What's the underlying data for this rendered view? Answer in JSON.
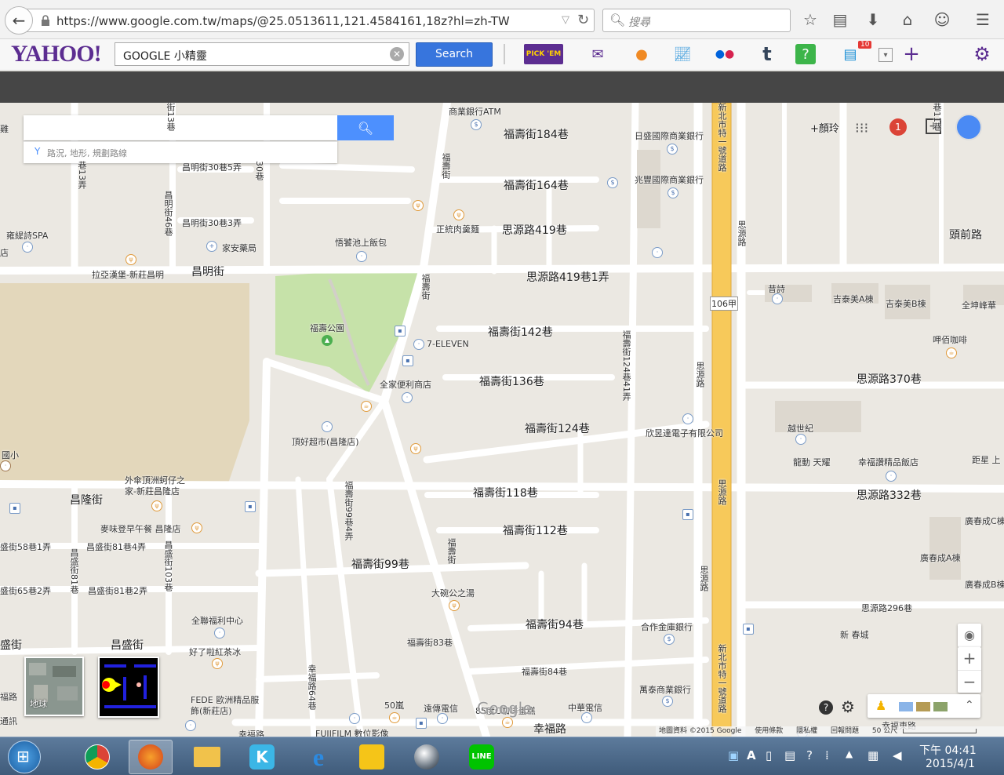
{
  "browser": {
    "url": "https://www.google.com.tw/maps/@25.0513611,121.4584161,18z?hl=zh-TW",
    "search_placeholder": "搜尋"
  },
  "yahoo": {
    "logo": "YAHOO!",
    "query": "GOOGLE 小精靈",
    "search_label": "Search",
    "pickem_label": "PICK 'EM",
    "news_badge": "10"
  },
  "map": {
    "search_hint": "路況, 地形, 規劃路線",
    "user_link": "+顏玲",
    "notification_count": "1",
    "earth_label": "地球",
    "footer": {
      "data": "地圖資料 ©2015 Google",
      "terms": "使用條款",
      "privacy": "隱私權",
      "report": "回報問題",
      "scale": "50 公尺"
    },
    "watermark": "Google",
    "labels": {
      "l1": "商業銀行ATM",
      "l2": "福壽街184巷",
      "l3": "日盛國際商業銀行",
      "l4": "福壽街164巷",
      "l5": "兆豐國際商業銀行",
      "l6": "昌明街30巷5弄",
      "l7": "昌明街30巷3弄",
      "l8": "正統肉羹麵",
      "l9": "思源路419巷",
      "l10": "頭前路",
      "l11": "雍緹詩SPA",
      "l12": "家安藥局",
      "l13": "悟饕池上飯包",
      "l14": "思源路419巷1弄",
      "l15": "拉亞漢堡-新莊昌明",
      "l16": "昌明街",
      "l17": "昔詩",
      "l18": "吉泰美A棟",
      "l19": "吉泰美B棟",
      "l20": "全坤峰華",
      "l21": "福壽公園",
      "l22": "福壽街142巷",
      "l23": "7-ELEVEN",
      "l24": "呷佰咖啡",
      "l25": "全家便利商店",
      "l26": "福壽街136巷",
      "l27": "思源路370巷",
      "l28": "越世紀",
      "l29": "頂好超市(昌隆店)",
      "l30": "福壽街124巷",
      "l31": "欣昱達電子有限公司",
      "l32": "龍動 天耀",
      "l33": "幸福讚精品飯店",
      "l34": "距星 上",
      "l35": "外傘頂洲蚵仔之家-新莊昌隆店",
      "l36": "昌隆街",
      "l37": "福壽街118巷",
      "l38": "思源路332巷",
      "l39": "麥味登早午餐 昌隆店",
      "l40": "福壽街112巷",
      "l41": "廣春成C棟",
      "l42": "昌盛街81巷4弄",
      "l43": "廣春成A棟",
      "l44": "福壽街99巷",
      "l45": "廣春成B棟",
      "l46": "昌盛街81巷2弄",
      "l47": "大碗公之湯",
      "l48": "思源路296巷",
      "l49": "全聯福利中心",
      "l50": "福壽街94巷",
      "l51": "合作金庫銀行",
      "l52": "新 春城",
      "l53": "昌盛街",
      "l54": "福壽街83巷",
      "l55": "好了啦紅茶冰",
      "l56": "福壽街84巷",
      "l57": "萬泰商業銀行",
      "l58": "FEDE 歐洲精品服飾(新莊店)",
      "l59": "50嵐",
      "l60": "遠傳電信",
      "l61": "85度C咖啡蛋糕",
      "l62": "中華電信",
      "l63": "幸福路",
      "l64": "FUJIFILM 數位影像",
      "l65": "幸福東路",
      "l66": "106甲",
      "l67": "國小",
      "l68": "店",
      "l69": "雞",
      "l70": "盛街58巷1弄",
      "l71": "盛街65巷2弄",
      "l72": "盛街",
      "l73": "福路",
      "l74": "通訊",
      "l75": "幸福路",
      "v1": "昌明街46巷",
      "v2": "巷13弄",
      "v3": "30巷",
      "v4": "福壽街",
      "v5": "福壽街",
      "v6": "新北市特一號道路",
      "v7": "思源路",
      "v8": "福壽街124巷41弄",
      "v9": "思源路",
      "v10": "思源路",
      "v11": "思源路",
      "v12": "福壽街99巷4弄",
      "v13": "福壽街",
      "v14": "昌盛街81巷",
      "v15": "昌盛街103巷",
      "v16": "幸福路64巷",
      "v17": "新北市特一號道路",
      "v18": "街13巷",
      "v19": "巷11巷"
    }
  },
  "taskbar": {
    "time": "下午 04:41",
    "date": "2015/4/1"
  }
}
